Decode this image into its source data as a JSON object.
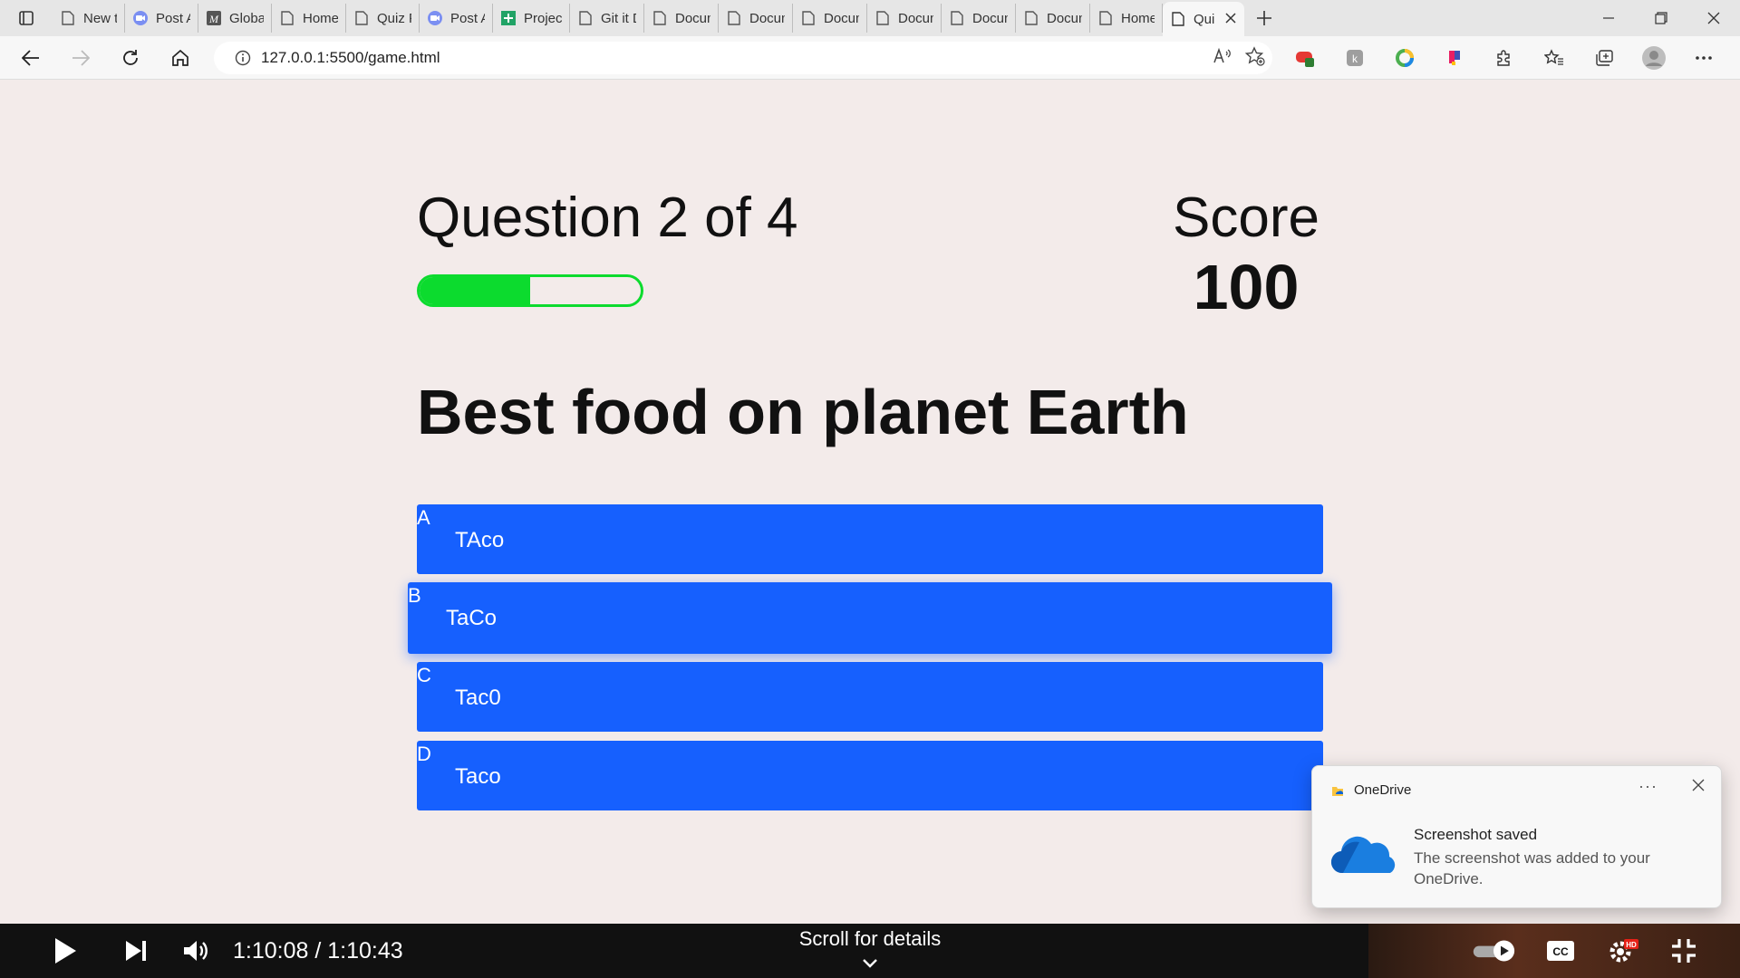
{
  "browser": {
    "tabs": [
      {
        "label": "New tab",
        "icon": "page-icon"
      },
      {
        "label": "Post Att",
        "icon": "video-icon"
      },
      {
        "label": "GlobalE",
        "icon": "m-logo-icon"
      },
      {
        "label": "Home P",
        "icon": "page-icon"
      },
      {
        "label": "Quiz Pa",
        "icon": "page-icon"
      },
      {
        "label": "Post Att",
        "icon": "video-icon"
      },
      {
        "label": "Project",
        "icon": "plus-green-icon"
      },
      {
        "label": "Git it Do",
        "icon": "page-icon"
      },
      {
        "label": "Docume",
        "icon": "page-icon"
      },
      {
        "label": "Docume",
        "icon": "page-icon"
      },
      {
        "label": "Docume",
        "icon": "page-icon"
      },
      {
        "label": "Docume",
        "icon": "page-icon"
      },
      {
        "label": "Docume",
        "icon": "page-icon"
      },
      {
        "label": "Docume",
        "icon": "page-icon"
      },
      {
        "label": "Home P",
        "icon": "page-icon"
      }
    ],
    "active_tab": {
      "label": "Qui",
      "icon": "page-icon"
    },
    "url": "127.0.0.1:5500/game.html"
  },
  "quiz": {
    "progress_text": "Question 2 of 4",
    "progress_fraction": 0.5,
    "score_label": "Score",
    "score_value": "100",
    "question": "Best food on planet Earth",
    "choices": [
      {
        "prefix": "A",
        "text": "TAco"
      },
      {
        "prefix": "B",
        "text": "TaCo"
      },
      {
        "prefix": "C",
        "text": "Tac0"
      },
      {
        "prefix": "D",
        "text": "Taco"
      }
    ],
    "hovered_choice": "B"
  },
  "toast": {
    "app": "OneDrive",
    "more": "···",
    "title": "Screenshot saved",
    "body": "The screenshot was added to your OneDrive."
  },
  "player": {
    "time": "1:10:08 / 1:10:43",
    "scroll_hint": "Scroll for details"
  },
  "colors": {
    "background": "#f3ebea",
    "choice": "#1660fe",
    "progress": "#0cdb2e"
  }
}
